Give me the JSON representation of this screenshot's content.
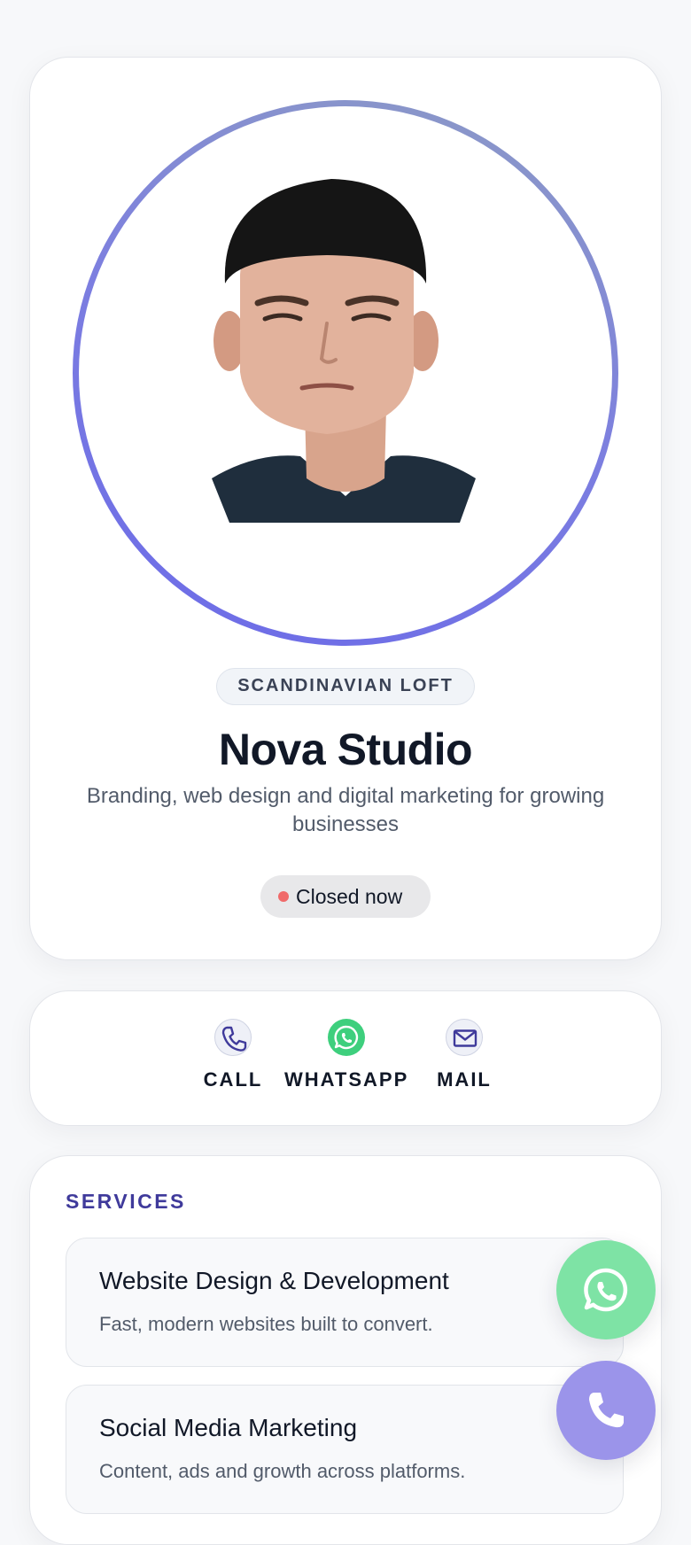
{
  "profile": {
    "category": "SCANDINAVIAN LOFT",
    "name": "Nova Studio",
    "tagline": "Branding, web design and digital marketing for growing businesses",
    "status": "Closed now",
    "status_color": "#f06a6a",
    "avatar_icon": "profile-photo"
  },
  "contact": {
    "actions": [
      {
        "label": "CALL",
        "icon": "phone-icon",
        "color": "#3f3a9b"
      },
      {
        "label": "WHATSAPP",
        "icon": "whatsapp-icon",
        "color": "#3ecf7d"
      },
      {
        "label": "MAIL",
        "icon": "mail-icon",
        "color": "#3f3a9b"
      }
    ]
  },
  "services": {
    "title": "SERVICES",
    "items": [
      {
        "name": "Website Design & Development",
        "description": "Fast, modern websites built to convert."
      },
      {
        "name": "Social Media Marketing",
        "description": "Content, ads and growth across platforms."
      }
    ]
  },
  "floating_actions": {
    "whatsapp_color": "#7ee3a5",
    "call_color": "#9b94ea"
  },
  "colors": {
    "accent": "#3f3a9b",
    "ring_gradient": [
      "#8d9cc4",
      "#6b6ae8"
    ]
  }
}
